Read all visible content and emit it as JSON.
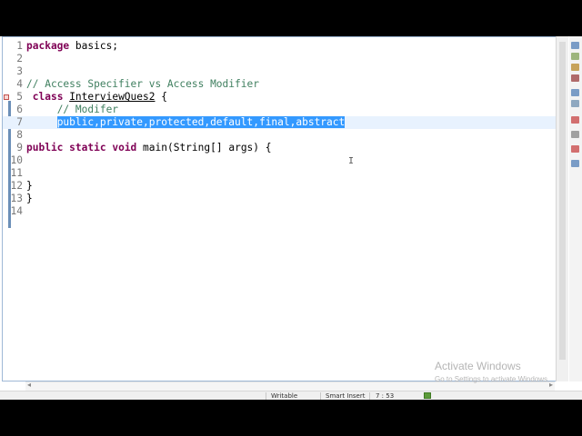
{
  "editor": {
    "lines": [
      {
        "num": "1",
        "segments": [
          {
            "text": "package",
            "cls": "kw"
          },
          {
            "text": " basics;",
            "cls": ""
          }
        ]
      },
      {
        "num": "2",
        "segments": []
      },
      {
        "num": "3",
        "segments": []
      },
      {
        "num": "4",
        "segments": [
          {
            "text": "// Access Specifier vs Access Modifier",
            "cls": "cm"
          }
        ]
      },
      {
        "num": "5",
        "segments": [
          {
            "text": " ",
            "cls": ""
          },
          {
            "text": "class",
            "cls": "kw"
          },
          {
            "text": " ",
            "cls": ""
          },
          {
            "text": "InterviewQues2",
            "cls": "ul"
          },
          {
            "text": " {",
            "cls": ""
          }
        ]
      },
      {
        "num": "6",
        "segments": [
          {
            "text": "     ",
            "cls": ""
          },
          {
            "text": "// Modifer",
            "cls": "cm"
          }
        ]
      },
      {
        "num": "7",
        "segments": [
          {
            "text": "     ",
            "cls": ""
          },
          {
            "text": "public,private,protected,default,final,abstract",
            "cls": "sel"
          }
        ]
      },
      {
        "num": "8",
        "segments": []
      },
      {
        "num": "9",
        "segments": [
          {
            "text": "public",
            "cls": "kw"
          },
          {
            "text": " ",
            "cls": ""
          },
          {
            "text": "static",
            "cls": "kw"
          },
          {
            "text": " ",
            "cls": ""
          },
          {
            "text": "void",
            "cls": "kw"
          },
          {
            "text": " main(String[] ",
            "cls": ""
          },
          {
            "text": "args",
            "cls": ""
          },
          {
            "text": ") {",
            "cls": ""
          }
        ]
      },
      {
        "num": "10",
        "segments": []
      },
      {
        "num": "11",
        "segments": []
      },
      {
        "num": "12",
        "segments": [
          {
            "text": "}",
            "cls": ""
          }
        ]
      },
      {
        "num": "13",
        "segments": [
          {
            "text": "}",
            "cls": ""
          }
        ]
      },
      {
        "num": "14",
        "segments": []
      }
    ],
    "current_line": "7"
  },
  "status": {
    "mode": "Writable",
    "insert": "Smart Insert",
    "position": "7 : 53"
  },
  "watermark": {
    "title": "Activate Windows",
    "subtitle": "Go to Settings to activate Windows."
  },
  "colors": {
    "keyword": "#7f0055",
    "comment": "#3f7f5f",
    "selection": "#3399ff",
    "line_number": "#787878"
  },
  "side_toolbar_icons": [
    "outline-icon",
    "task-list-icon",
    "console-icon",
    "problems-icon",
    "javadoc-icon",
    "declaration-icon",
    "search-view-icon",
    "progress-view-icon",
    "history-icon",
    "bookmarks-icon"
  ]
}
